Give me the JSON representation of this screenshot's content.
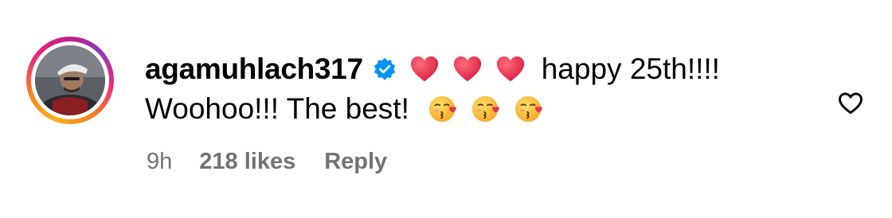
{
  "comment": {
    "username": "agamuhlach317",
    "line1_text": "happy 25th!!!!",
    "line2_text": "Woohoo!!! The best!",
    "time": "9h",
    "likes": "218 likes",
    "reply_label": "Reply"
  },
  "icons": {
    "verified": "verified-badge-icon",
    "heart_emoji": "red-heart-emoji",
    "kiss_emoji": "face-blowing-kiss-emoji",
    "like": "heart-outline-icon"
  },
  "colors": {
    "verified_blue": "#0095f6",
    "heart_red": "#e8334f",
    "meta_gray": "#737373",
    "ring_start": "#f9b021",
    "ring_end": "#c81d87"
  }
}
